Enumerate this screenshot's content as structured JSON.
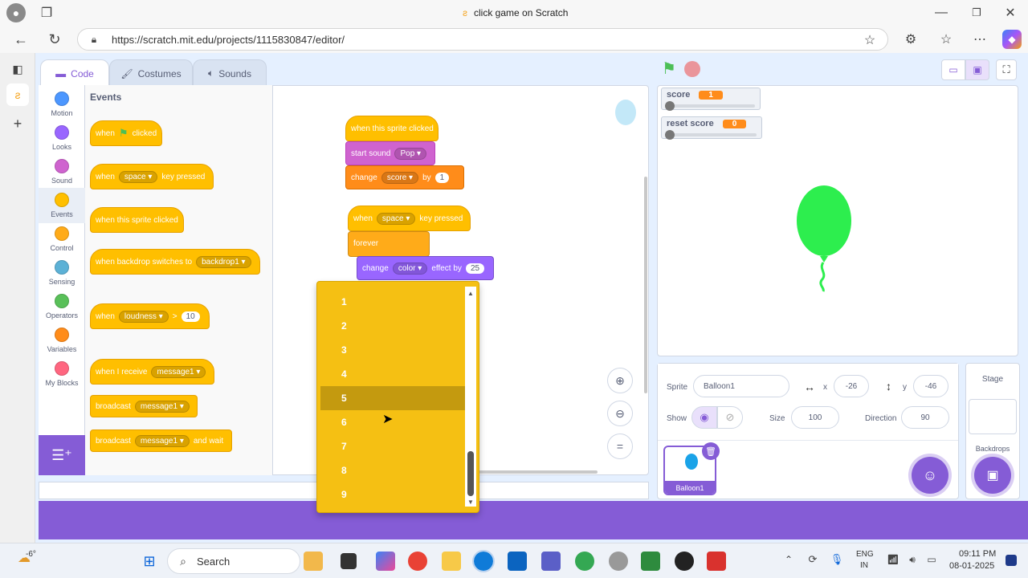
{
  "browser": {
    "tab_title": "click game on Scratch",
    "url": "https://scratch.mit.edu/projects/1115830847/editor/"
  },
  "editor_tabs": [
    {
      "label": "Code",
      "active": true
    },
    {
      "label": "Costumes",
      "active": false
    },
    {
      "label": "Sounds",
      "active": false
    }
  ],
  "categories": [
    {
      "label": "Motion",
      "color": "#4c97ff"
    },
    {
      "label": "Looks",
      "color": "#9966ff"
    },
    {
      "label": "Sound",
      "color": "#cf63cf"
    },
    {
      "label": "Events",
      "color": "#ffbf00"
    },
    {
      "label": "Control",
      "color": "#ffab19"
    },
    {
      "label": "Sensing",
      "color": "#5cb1d6"
    },
    {
      "label": "Operators",
      "color": "#59c059"
    },
    {
      "label": "Variables",
      "color": "#ff8c1a"
    },
    {
      "label": "My Blocks",
      "color": "#ff6680"
    }
  ],
  "palette": {
    "heading": "Events",
    "when_flag_when": "when",
    "when_flag_clicked": "clicked",
    "key_when": "when",
    "key_value": "space",
    "key_pressed": "key pressed",
    "sprite_clicked": "when this sprite clicked",
    "backdrop_label": "when backdrop switches to",
    "backdrop_value": "backdrop1",
    "loudness_when": "when",
    "loudness_value": "loudness",
    "loudness_op": ">",
    "loudness_num": "10",
    "receive_label": "when I receive",
    "receive_value": "message1",
    "broadcast_label": "broadcast",
    "broadcast_value": "message1",
    "broadcast_wait_label": "broadcast",
    "broadcast_wait_value": "message1",
    "broadcast_wait_suffix": "and wait"
  },
  "script1": {
    "hat": "when this sprite clicked",
    "sound_label": "start sound",
    "sound_value": "Pop",
    "change_label": "change",
    "change_var": "score",
    "change_by": "by",
    "change_num": "1"
  },
  "script2": {
    "when": "when",
    "key": "space",
    "pressed": "key pressed",
    "forever": "forever",
    "change_label": "change",
    "effect": "color",
    "effect_by": "effect by",
    "effect_num": "25"
  },
  "dropdown": {
    "options": [
      "1",
      "2",
      "3",
      "4",
      "5",
      "6",
      "7",
      "8",
      "9"
    ],
    "selected": "5"
  },
  "monitors": [
    {
      "label": "score",
      "value": "1"
    },
    {
      "label": "reset score",
      "value": "0"
    }
  ],
  "sprite_info": {
    "sprite_label": "Sprite",
    "sprite_name": "Balloon1",
    "x_label": "x",
    "x_value": "-26",
    "y_label": "y",
    "y_value": "-46",
    "show_label": "Show",
    "size_label": "Size",
    "size_value": "100",
    "direction_label": "Direction",
    "direction_value": "90",
    "thumb_name": "Balloon1"
  },
  "stage_pane": {
    "title": "Stage",
    "backdrops_label": "Backdrops"
  },
  "taskbar": {
    "weather": "-6°",
    "search_placeholder": "Search",
    "lang1": "ENG",
    "lang2": "IN",
    "time": "09:11 PM",
    "date": "08-01-2025"
  }
}
